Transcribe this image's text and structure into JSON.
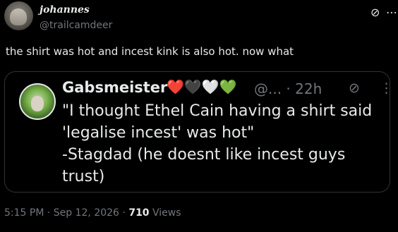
{
  "tweet": {
    "author_name": "johannes",
    "author_handle": "@trailcamdeer",
    "text": "the shirt was hot and incest kink is also hot. now what",
    "icons": {
      "grok": "grok-icon",
      "more": "more-icon"
    }
  },
  "quote": {
    "name": "Gabsmeister",
    "hearts": "❤️🖤🤍💚",
    "handle_time": "@... · 22h",
    "text": "\"I thought Ethel Cain having a shirt said 'legalise incest' was hot\"\n-Stagdad (he doesnt like incest guys trust)"
  },
  "meta": {
    "time": "5:15 PM",
    "sep": "·",
    "date": "Sep 12, 2026",
    "views_count": "710",
    "views_label": "Views"
  },
  "colors": {
    "background": "#000000",
    "text": "#e7e9ea",
    "secondary": "#71767b",
    "border": "#2f3336"
  }
}
